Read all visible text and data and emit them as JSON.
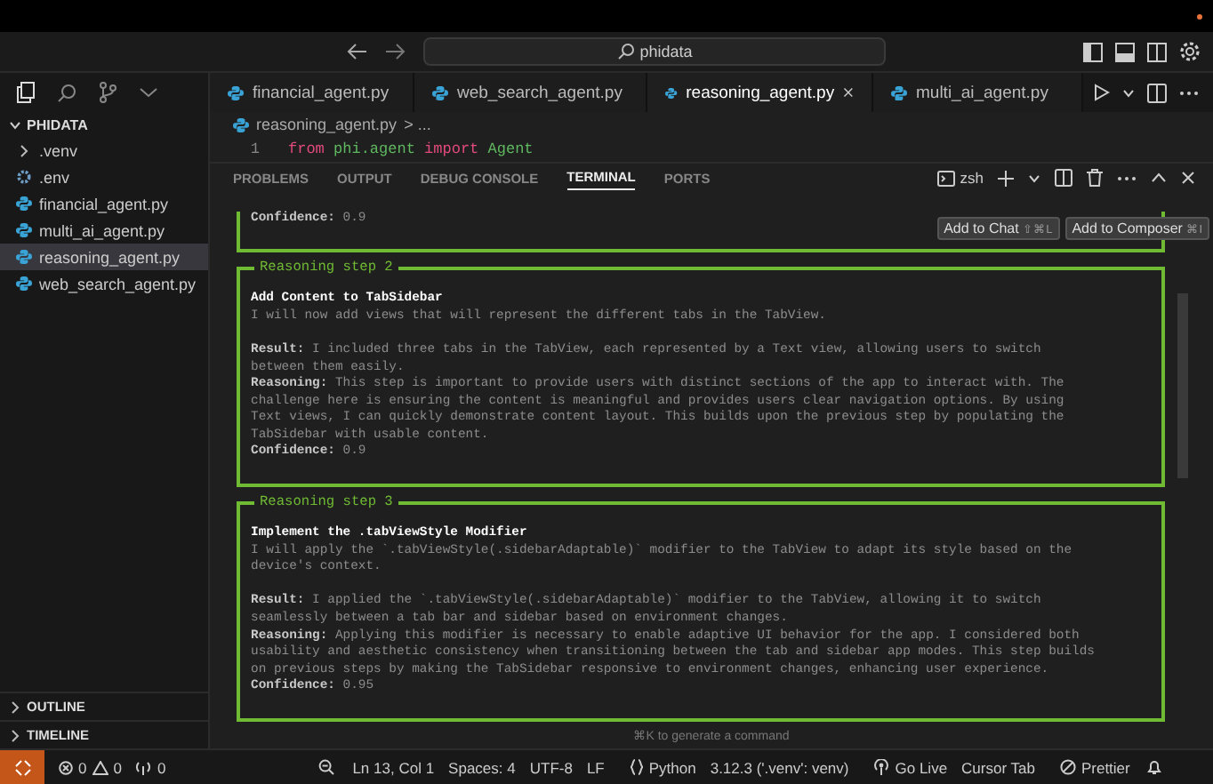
{
  "title_bar": {
    "search": "phidata"
  },
  "sidebar": {
    "title": "PHIDATA",
    "items": [
      {
        "kind": "folder",
        "label": ".venv",
        "selected": false
      },
      {
        "kind": "env",
        "label": ".env",
        "selected": false
      },
      {
        "kind": "python",
        "label": "financial_agent.py",
        "selected": false
      },
      {
        "kind": "python",
        "label": "multi_ai_agent.py",
        "selected": false
      },
      {
        "kind": "python",
        "label": "reasoning_agent.py",
        "selected": true
      },
      {
        "kind": "python",
        "label": "web_search_agent.py",
        "selected": false
      }
    ],
    "sections": [
      "OUTLINE",
      "TIMELINE"
    ]
  },
  "editor_tabs": [
    {
      "label": "financial_agent.py",
      "selected": false
    },
    {
      "label": "web_search_agent.py",
      "selected": false
    },
    {
      "label": "reasoning_agent.py",
      "selected": true
    },
    {
      "label": "multi_ai_agent.py",
      "selected": false
    }
  ],
  "breadcrumb": {
    "file": "reasoning_agent.py",
    "trail": "> ..."
  },
  "code": {
    "line_number": "1",
    "tokens": [
      {
        "text": "from",
        "kind": "keyword"
      },
      {
        "text": "phi.agent",
        "kind": "module"
      },
      {
        "text": "import",
        "kind": "keyword"
      },
      {
        "text": "Agent",
        "kind": "class"
      }
    ]
  },
  "panel": {
    "tabs": [
      {
        "label": "PROBLEMS",
        "selected": false
      },
      {
        "label": "OUTPUT",
        "selected": false
      },
      {
        "label": "DEBUG CONSOLE",
        "selected": false
      },
      {
        "label": "TERMINAL",
        "selected": true
      },
      {
        "label": "PORTS",
        "selected": false
      }
    ],
    "shell": "zsh",
    "steps": [
      {
        "confidence": "**Confidence:** 0.9"
      },
      {
        "title": "Reasoning step 2",
        "heading": "Add Content to TabSidebar",
        "description": [
          "I will now add views that will represent the different tabs in the TabView."
        ],
        "result": [
          "**Result:** I included three tabs in the TabView, each represented by a Text view, allowing users to switch",
          "between them easily."
        ],
        "reasoning": [
          "**Reasoning:** This step is important to provide users with distinct sections of the app to interact with. The",
          "challenge here is ensuring the content is meaningful and provides users clear navigation options. By using",
          "Text views, I can quickly demonstrate content layout. This builds upon the previous step by populating the",
          "TabSidebar with usable content."
        ],
        "confidence": "**Confidence:** 0.9"
      },
      {
        "title": "Reasoning step 3",
        "heading": "Implement the .tabViewStyle Modifier",
        "description": [
          "I will apply the `.tabViewStyle(.sidebarAdaptable)` modifier to the TabView to adapt its style based on the",
          "device's context."
        ],
        "result": [
          "**Result:** I applied the `.tabViewStyle(.sidebarAdaptable)` modifier to the TabView, allowing it to switch",
          "seamlessly between a tab bar and sidebar based on environment changes."
        ],
        "reasoning": [
          "**Reasoning:** Applying this modifier is necessary to enable adaptive UI behavior for the app. I considered both",
          "usability and aesthetic consistency when transitioning between the tab and sidebar app modes. This step builds",
          "on previous steps by making the TabSidebar responsive to environment changes, enhancing user experience."
        ],
        "confidence": "**Confidence:** 0.95"
      }
    ],
    "hint": "⌘K to generate a command"
  },
  "chat_actions": [
    {
      "label": "Add to Chat",
      "shortcut": "⇧⌘L"
    },
    {
      "label": "Add to Composer",
      "shortcut": "⌘I"
    }
  ],
  "status_bar": {
    "errors": "0",
    "warnings": "0",
    "ports": "0",
    "items": [
      {
        "kind": "text",
        "text": "Ln 13, Col 1"
      },
      {
        "kind": "text",
        "text": "Spaces: 4"
      },
      {
        "kind": "text",
        "text": "UTF-8"
      },
      {
        "kind": "text",
        "text": "LF"
      },
      {
        "kind": "python",
        "text": "Python"
      },
      {
        "kind": "text",
        "text": "3.12.3 ('.venv': venv)"
      },
      {
        "kind": "live",
        "text": "Go Live"
      },
      {
        "kind": "text",
        "text": "Cursor Tab"
      },
      {
        "kind": "prettier",
        "text": "Prettier"
      }
    ]
  }
}
